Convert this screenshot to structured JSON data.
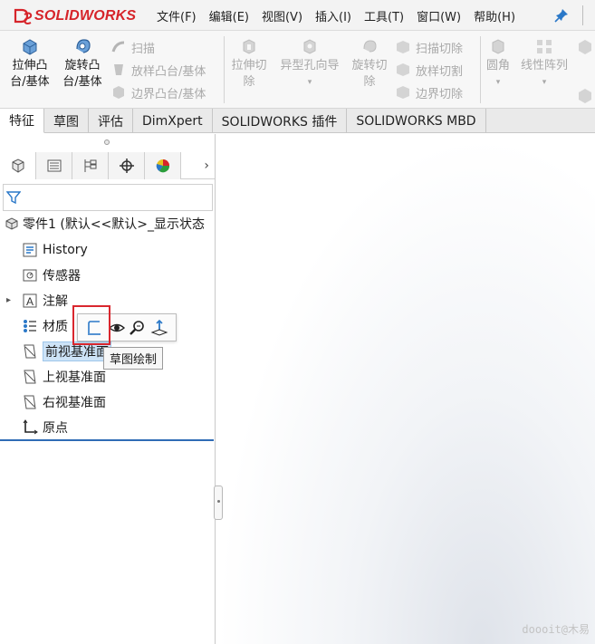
{
  "app": {
    "logo_text": "SOLIDWORKS",
    "brand_color": "#d6242a"
  },
  "menu": [
    "文件(F)",
    "编辑(E)",
    "视图(V)",
    "插入(I)",
    "工具(T)",
    "窗口(W)",
    "帮助(H)"
  ],
  "commands": {
    "extrude_boss": [
      "拉伸凸",
      "台/基体"
    ],
    "revolve_boss": [
      "旋转凸",
      "台/基体"
    ],
    "sweep": "扫描",
    "loft_boss": "放样凸台/基体",
    "boundary_boss": "边界凸台/基体",
    "extrude_cut": [
      "拉伸切",
      "除"
    ],
    "hole_wizard": "异型孔向导",
    "revolve_cut": [
      "旋转切",
      "除"
    ],
    "swept_cut": "扫描切除",
    "lofted_cut": "放样切割",
    "boundary_cut": "边界切除",
    "fillet": "圆角",
    "linear_pattern": "线性阵列"
  },
  "tabs": [
    "特征",
    "草图",
    "评估",
    "DimXpert",
    "SOLIDWORKS 插件",
    "SOLIDWORKS MBD"
  ],
  "active_tab": "特征",
  "tree": {
    "root": "零件1 (默认<<默认>_显示状态",
    "items": [
      "History",
      "传感器",
      "注解",
      "材质",
      "前视基准面",
      "上视基准面",
      "右视基准面",
      "原点"
    ]
  },
  "context_toolbar": {
    "tooltip": "草图绘制"
  },
  "watermark": "doooit@木易"
}
